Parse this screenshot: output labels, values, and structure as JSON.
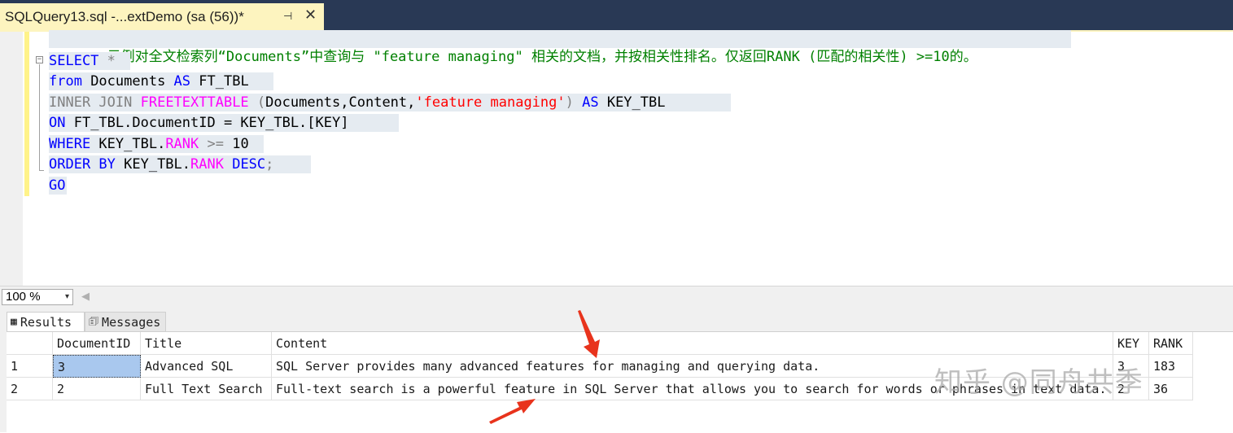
{
  "tab": {
    "title": "SQLQuery13.sql -...extDemo (sa (56))*",
    "pin_glyph": "⊣",
    "close_glyph": "✕"
  },
  "editor": {
    "line1": "-- 示例对全文检索列“Documents”中查询与 \"feature managing\" 相关的文档，并按相关性排名。仅返回RANK (匹配的相关性) >=10的。",
    "t_select": "SELECT",
    "t_star": " *",
    "t_from": "from",
    "t_documents": " Documents ",
    "t_as": "AS",
    "t_ft_tbl": " FT_TBL",
    "t_inner_join": "INNER JOIN",
    "t_space": " ",
    "t_freetexttable": "FREETEXTTABLE",
    "t_paren_open": " (",
    "t_documents_content": "Documents,Content,",
    "t_literal": "'feature managing'",
    "t_paren_close": ")",
    "t_as2": " AS",
    "t_key_tbl": " KEY_TBL",
    "t_on": "ON",
    "t_on_expr": " FT_TBL.DocumentID = KEY_TBL.[KEY]",
    "t_where": "WHERE",
    "t_key_tbl_dot": " KEY_TBL.",
    "t_rank": "RANK",
    "t_gte": " >=",
    "t_ten": " 10",
    "t_order_by": "ORDER BY",
    "t_key_tbl_dot2": " KEY_TBL.",
    "t_rank2": "RANK",
    "t_desc": " DESC",
    "t_semicolon": ";",
    "t_go": "GO",
    "fold_glyph": "−"
  },
  "zoom": {
    "value": "100 %",
    "dropdown_glyph": "▾",
    "scroll_left_glyph": "◀"
  },
  "results_tabs": {
    "results_label": "Results",
    "messages_label": "Messages",
    "results_icon": "▦",
    "messages_icon": "🗊"
  },
  "grid": {
    "columns": [
      "DocumentID",
      "Title",
      "Content",
      "KEY",
      "RANK"
    ],
    "rows": [
      {
        "num": "1",
        "DocumentID": "3",
        "Title": "Advanced SQL",
        "Content": "SQL Server provides many advanced features for managing and querying data.",
        "KEY": "3",
        "RANK": "183"
      },
      {
        "num": "2",
        "DocumentID": "2",
        "Title": "Full Text Search",
        "Content": "Full-text search is a powerful feature in SQL Server that allows you to search for words or phrases in text data.",
        "KEY": "2",
        "RANK": "36"
      }
    ]
  },
  "watermark": "知乎 @同舟共季",
  "colors": {
    "tabbar": "#293955",
    "active_tab": "#fdf4bf",
    "keyword": "#0000ff",
    "string": "#ff0000",
    "comment": "#008000",
    "function_name": "#ff00ff",
    "operator": "#808080",
    "arrow": "#e8331c",
    "selection": "#a9c8ee"
  }
}
